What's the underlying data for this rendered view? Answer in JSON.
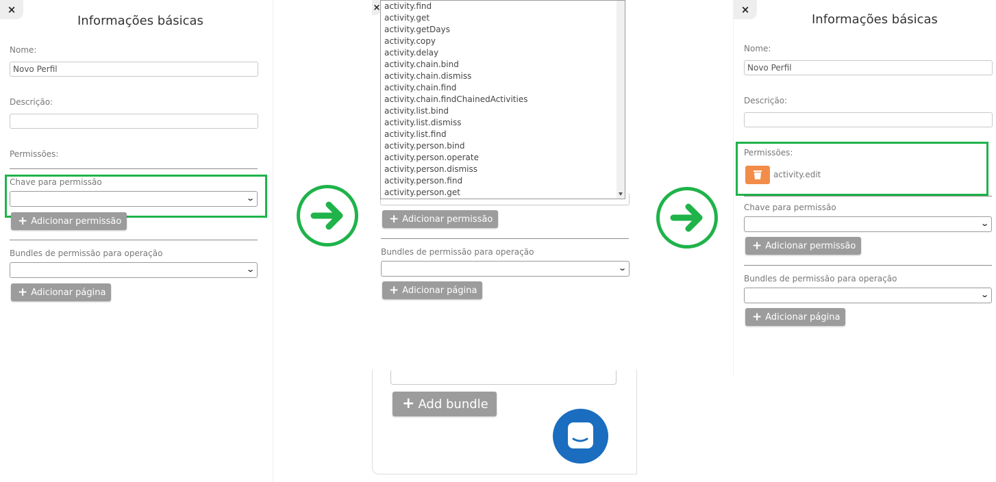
{
  "colors": {
    "highlight": "#1fb34a",
    "button": "#9c9c9c",
    "delete_button": "#f28d49",
    "chat_bubble": "#1a6dbf"
  },
  "left": {
    "close_icon": "×",
    "title": "Informações básicas",
    "name_label": "Nome:",
    "name_value": "Novo Perfil",
    "description_label": "Descrição:",
    "description_value": "",
    "permissions_label": "Permissões:",
    "permission_key_label": "Chave para permissão",
    "add_permission": "Adicionar permissão",
    "bundles_label": "Bundles de permissão para operação",
    "add_page": "Adicionar página"
  },
  "middle": {
    "close_icon": "×",
    "options": [
      "activity.find",
      "activity.get",
      "activity.getDays",
      "activity.copy",
      "activity.delay",
      "activity.chain.bind",
      "activity.chain.dismiss",
      "activity.chain.find",
      "activity.chain.findChainedActivities",
      "activity.list.bind",
      "activity.list.dismiss",
      "activity.list.find",
      "activity.person.bind",
      "activity.person.operate",
      "activity.person.dismiss",
      "activity.person.find",
      "activity.person.get"
    ],
    "add_permission": "Adicionar permissão",
    "bundles_label": "Bundles de permissão para operação",
    "add_page": "Adicionar página",
    "add_bundle": "Add bundle"
  },
  "right": {
    "close_icon": "×",
    "title": "Informações básicas",
    "name_label": "Nome:",
    "name_value": "Novo Perfil",
    "description_label": "Descrição:",
    "description_value": "",
    "permissions_label": "Permissões:",
    "permission_item": "activity.edit",
    "permission_key_label": "Chave para permissão",
    "add_permission": "Adicionar permissão",
    "bundles_label": "Bundles de permissão para operação",
    "add_page": "Adicionar página"
  },
  "icons": [
    "close-icon",
    "chevron-down-icon",
    "plus-icon",
    "arrow-right-icon",
    "trash-icon",
    "chat-icon"
  ]
}
